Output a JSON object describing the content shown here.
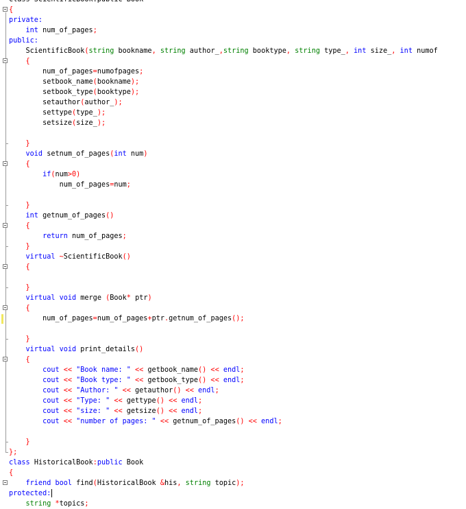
{
  "editor": {
    "colors": {
      "background": "#ffffff",
      "keyword": "#0000ff",
      "type": "#008000",
      "identifier": "#000000",
      "number": "#ff0000",
      "string": "#0000ff",
      "punctuation": "#ff0000",
      "fold_line": "#9a9a9a",
      "change_marker": "#f1e85f"
    },
    "gutter_icons": [
      "fold-minus-icon",
      "fold-end-icon",
      "change-marker-icon"
    ],
    "lines": [
      [
        {
          "t": "class ScientificBook:public Book",
          "c": "plain"
        }
      ],
      [
        {
          "t": "{",
          "c": "pun"
        }
      ],
      [
        {
          "t": "private:",
          "c": "kw"
        }
      ],
      [
        {
          "t": "    int ",
          "c": "kw"
        },
        {
          "t": "num_of_pages",
          "c": "plain"
        },
        {
          "t": ";",
          "c": "pun"
        }
      ],
      [
        {
          "t": "public:",
          "c": "kw"
        }
      ],
      [
        {
          "t": "    ScientificBook",
          "c": "plain"
        },
        {
          "t": "(",
          "c": "pun"
        },
        {
          "t": "string ",
          "c": "type"
        },
        {
          "t": "bookname",
          "c": "plain"
        },
        {
          "t": ", ",
          "c": "pun"
        },
        {
          "t": "string ",
          "c": "type"
        },
        {
          "t": "author_",
          "c": "plain"
        },
        {
          "t": ",",
          "c": "pun"
        },
        {
          "t": "string ",
          "c": "type"
        },
        {
          "t": "booktype",
          "c": "plain"
        },
        {
          "t": ", ",
          "c": "pun"
        },
        {
          "t": "string ",
          "c": "type"
        },
        {
          "t": "type_",
          "c": "plain"
        },
        {
          "t": ", ",
          "c": "pun"
        },
        {
          "t": "int ",
          "c": "kw"
        },
        {
          "t": "size_",
          "c": "plain"
        },
        {
          "t": ", ",
          "c": "pun"
        },
        {
          "t": "int ",
          "c": "kw"
        },
        {
          "t": "numof",
          "c": "plain"
        }
      ],
      [
        {
          "t": "    {",
          "c": "pun"
        }
      ],
      [
        {
          "t": "        num_of_pages",
          "c": "plain"
        },
        {
          "t": "=",
          "c": "pun"
        },
        {
          "t": "numofpages",
          "c": "plain"
        },
        {
          "t": ";",
          "c": "pun"
        }
      ],
      [
        {
          "t": "        setbook_name",
          "c": "plain"
        },
        {
          "t": "(",
          "c": "pun"
        },
        {
          "t": "bookname",
          "c": "plain"
        },
        {
          "t": ");",
          "c": "pun"
        }
      ],
      [
        {
          "t": "        setbook_type",
          "c": "plain"
        },
        {
          "t": "(",
          "c": "pun"
        },
        {
          "t": "booktype",
          "c": "plain"
        },
        {
          "t": ");",
          "c": "pun"
        }
      ],
      [
        {
          "t": "        setauthor",
          "c": "plain"
        },
        {
          "t": "(",
          "c": "pun"
        },
        {
          "t": "author_",
          "c": "plain"
        },
        {
          "t": ");",
          "c": "pun"
        }
      ],
      [
        {
          "t": "        settype",
          "c": "plain"
        },
        {
          "t": "(",
          "c": "pun"
        },
        {
          "t": "type_",
          "c": "plain"
        },
        {
          "t": ");",
          "c": "pun"
        }
      ],
      [
        {
          "t": "        setsize",
          "c": "plain"
        },
        {
          "t": "(",
          "c": "pun"
        },
        {
          "t": "size_",
          "c": "plain"
        },
        {
          "t": ");",
          "c": "pun"
        }
      ],
      [
        {
          "t": "",
          "c": "plain"
        }
      ],
      [
        {
          "t": "    }",
          "c": "pun"
        }
      ],
      [
        {
          "t": "    void ",
          "c": "kw"
        },
        {
          "t": "setnum_of_pages",
          "c": "plain"
        },
        {
          "t": "(",
          "c": "pun"
        },
        {
          "t": "int ",
          "c": "kw"
        },
        {
          "t": "num",
          "c": "plain"
        },
        {
          "t": ")",
          "c": "pun"
        }
      ],
      [
        {
          "t": "    {",
          "c": "pun"
        }
      ],
      [
        {
          "t": "        if",
          "c": "kw"
        },
        {
          "t": "(",
          "c": "pun"
        },
        {
          "t": "num",
          "c": "plain"
        },
        {
          "t": ">",
          "c": "pun"
        },
        {
          "t": "0",
          "c": "num"
        },
        {
          "t": ")",
          "c": "pun"
        }
      ],
      [
        {
          "t": "            num_of_pages",
          "c": "plain"
        },
        {
          "t": "=",
          "c": "pun"
        },
        {
          "t": "num",
          "c": "plain"
        },
        {
          "t": ";",
          "c": "pun"
        }
      ],
      [
        {
          "t": "",
          "c": "plain"
        }
      ],
      [
        {
          "t": "    }",
          "c": "pun"
        }
      ],
      [
        {
          "t": "    int ",
          "c": "kw"
        },
        {
          "t": "getnum_of_pages",
          "c": "plain"
        },
        {
          "t": "()",
          "c": "pun"
        }
      ],
      [
        {
          "t": "    {",
          "c": "pun"
        }
      ],
      [
        {
          "t": "        return ",
          "c": "kw"
        },
        {
          "t": "num_of_pages",
          "c": "plain"
        },
        {
          "t": ";",
          "c": "pun"
        }
      ],
      [
        {
          "t": "    }",
          "c": "pun"
        }
      ],
      [
        {
          "t": "    virtual ",
          "c": "kw"
        },
        {
          "t": "~",
          "c": "pun"
        },
        {
          "t": "ScientificBook",
          "c": "plain"
        },
        {
          "t": "()",
          "c": "pun"
        }
      ],
      [
        {
          "t": "    {",
          "c": "pun"
        }
      ],
      [
        {
          "t": "",
          "c": "plain"
        }
      ],
      [
        {
          "t": "    }",
          "c": "pun"
        }
      ],
      [
        {
          "t": "    virtual void ",
          "c": "kw"
        },
        {
          "t": "merge ",
          "c": "plain"
        },
        {
          "t": "(",
          "c": "pun"
        },
        {
          "t": "Book",
          "c": "plain"
        },
        {
          "t": "* ",
          "c": "pun"
        },
        {
          "t": "ptr",
          "c": "plain"
        },
        {
          "t": ")",
          "c": "pun"
        }
      ],
      [
        {
          "t": "    {",
          "c": "pun"
        }
      ],
      [
        {
          "t": "        num_of_pages",
          "c": "plain"
        },
        {
          "t": "=",
          "c": "pun"
        },
        {
          "t": "num_of_pages",
          "c": "plain"
        },
        {
          "t": "+",
          "c": "pun"
        },
        {
          "t": "ptr",
          "c": "plain"
        },
        {
          "t": ".",
          "c": "pun"
        },
        {
          "t": "getnum_of_pages",
          "c": "plain"
        },
        {
          "t": "();",
          "c": "pun"
        }
      ],
      [
        {
          "t": "",
          "c": "plain"
        }
      ],
      [
        {
          "t": "    }",
          "c": "pun"
        }
      ],
      [
        {
          "t": "    virtual void ",
          "c": "kw"
        },
        {
          "t": "print_details",
          "c": "plain"
        },
        {
          "t": "()",
          "c": "pun"
        }
      ],
      [
        {
          "t": "    {",
          "c": "pun"
        }
      ],
      [
        {
          "t": "        cout ",
          "c": "kw"
        },
        {
          "t": "<< ",
          "c": "pun"
        },
        {
          "t": "\"Book name: \" ",
          "c": "str"
        },
        {
          "t": "<< ",
          "c": "pun"
        },
        {
          "t": "getbook_name",
          "c": "plain"
        },
        {
          "t": "() << ",
          "c": "pun"
        },
        {
          "t": "endl",
          "c": "kw"
        },
        {
          "t": ";",
          "c": "pun"
        }
      ],
      [
        {
          "t": "        cout ",
          "c": "kw"
        },
        {
          "t": "<< ",
          "c": "pun"
        },
        {
          "t": "\"Book type: \" ",
          "c": "str"
        },
        {
          "t": "<< ",
          "c": "pun"
        },
        {
          "t": "getbook_type",
          "c": "plain"
        },
        {
          "t": "() << ",
          "c": "pun"
        },
        {
          "t": "endl",
          "c": "kw"
        },
        {
          "t": ";",
          "c": "pun"
        }
      ],
      [
        {
          "t": "        cout ",
          "c": "kw"
        },
        {
          "t": "<< ",
          "c": "pun"
        },
        {
          "t": "\"Author: \" ",
          "c": "str"
        },
        {
          "t": "<< ",
          "c": "pun"
        },
        {
          "t": "getauthor",
          "c": "plain"
        },
        {
          "t": "() << ",
          "c": "pun"
        },
        {
          "t": "endl",
          "c": "kw"
        },
        {
          "t": ";",
          "c": "pun"
        }
      ],
      [
        {
          "t": "        cout ",
          "c": "kw"
        },
        {
          "t": "<< ",
          "c": "pun"
        },
        {
          "t": "\"Type: \" ",
          "c": "str"
        },
        {
          "t": "<< ",
          "c": "pun"
        },
        {
          "t": "gettype",
          "c": "plain"
        },
        {
          "t": "() << ",
          "c": "pun"
        },
        {
          "t": "endl",
          "c": "kw"
        },
        {
          "t": ";",
          "c": "pun"
        }
      ],
      [
        {
          "t": "        cout ",
          "c": "kw"
        },
        {
          "t": "<< ",
          "c": "pun"
        },
        {
          "t": "\"size: \" ",
          "c": "str"
        },
        {
          "t": "<< ",
          "c": "pun"
        },
        {
          "t": "getsize",
          "c": "plain"
        },
        {
          "t": "() << ",
          "c": "pun"
        },
        {
          "t": "endl",
          "c": "kw"
        },
        {
          "t": ";",
          "c": "pun"
        }
      ],
      [
        {
          "t": "        cout ",
          "c": "kw"
        },
        {
          "t": "<< ",
          "c": "pun"
        },
        {
          "t": "\"number of pages: \" ",
          "c": "str"
        },
        {
          "t": "<< ",
          "c": "pun"
        },
        {
          "t": "getnum_of_pages",
          "c": "plain"
        },
        {
          "t": "() << ",
          "c": "pun"
        },
        {
          "t": "endl",
          "c": "kw"
        },
        {
          "t": ";",
          "c": "pun"
        }
      ],
      [
        {
          "t": "",
          "c": "plain"
        }
      ],
      [
        {
          "t": "    }",
          "c": "pun"
        }
      ],
      [
        {
          "t": "};",
          "c": "pun"
        }
      ],
      [
        {
          "t": "class ",
          "c": "kw"
        },
        {
          "t": "HistoricalBook",
          "c": "plain"
        },
        {
          "t": ":",
          "c": "pun"
        },
        {
          "t": "public ",
          "c": "kw"
        },
        {
          "t": "Book",
          "c": "plain"
        }
      ],
      [
        {
          "t": "{",
          "c": "pun"
        }
      ],
      [
        {
          "t": "    friend bool ",
          "c": "kw"
        },
        {
          "t": "find",
          "c": "plain"
        },
        {
          "t": "(",
          "c": "pun"
        },
        {
          "t": "HistoricalBook ",
          "c": "plain"
        },
        {
          "t": "&",
          "c": "pun"
        },
        {
          "t": "his",
          "c": "plain"
        },
        {
          "t": ", ",
          "c": "pun"
        },
        {
          "t": "string ",
          "c": "type"
        },
        {
          "t": "topic",
          "c": "plain"
        },
        {
          "t": ");",
          "c": "pun"
        }
      ],
      [
        {
          "t": "protected:",
          "c": "kw"
        }
      ],
      [
        {
          "t": "    string ",
          "c": "type"
        },
        {
          "t": "*",
          "c": "pun"
        },
        {
          "t": "topics",
          "c": "plain"
        },
        {
          "t": ";",
          "c": "pun"
        }
      ]
    ]
  }
}
